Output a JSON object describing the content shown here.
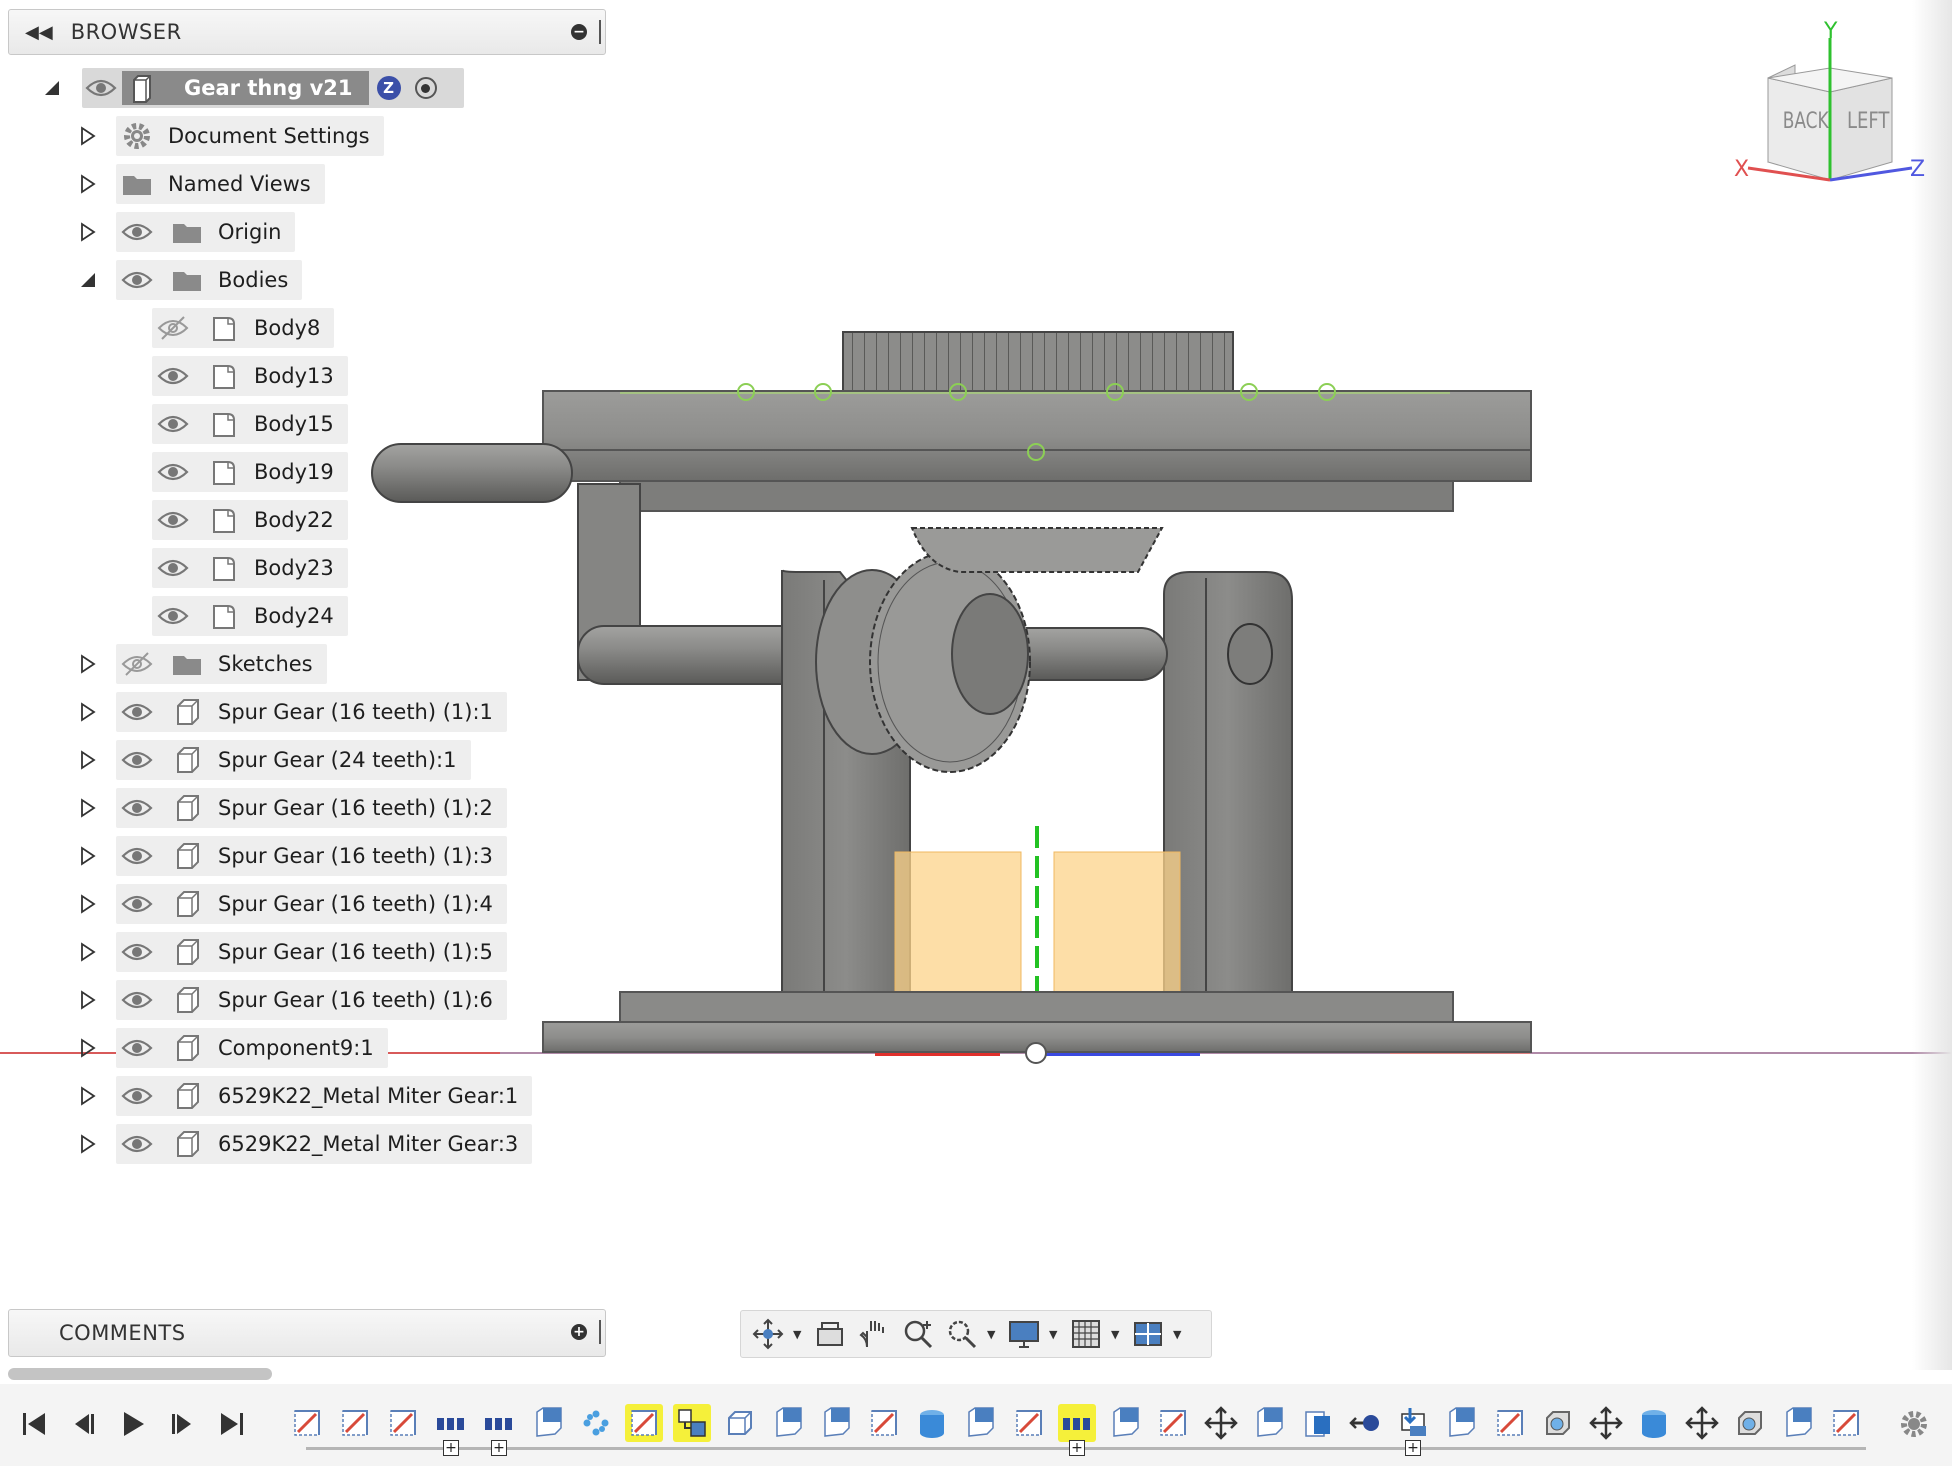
{
  "browser": {
    "title": "BROWSER",
    "root": {
      "label": "Gear thng v21",
      "badge": "Z"
    },
    "items": [
      {
        "label": "Document Settings",
        "icon": "gear",
        "expand": "closed",
        "eye": "none"
      },
      {
        "label": "Named Views",
        "icon": "folder",
        "expand": "closed",
        "eye": "none"
      },
      {
        "label": "Origin",
        "icon": "folder",
        "expand": "closed",
        "eye": "visible"
      },
      {
        "label": "Bodies",
        "icon": "folder",
        "expand": "open",
        "eye": "visible"
      },
      {
        "label": "Body8",
        "icon": "body",
        "expand": "none",
        "eye": "hidden",
        "child": true
      },
      {
        "label": "Body13",
        "icon": "body",
        "expand": "none",
        "eye": "visible",
        "child": true
      },
      {
        "label": "Body15",
        "icon": "body",
        "expand": "none",
        "eye": "visible",
        "child": true
      },
      {
        "label": "Body19",
        "icon": "body",
        "expand": "none",
        "eye": "visible",
        "child": true
      },
      {
        "label": "Body22",
        "icon": "body",
        "expand": "none",
        "eye": "visible",
        "child": true
      },
      {
        "label": "Body23",
        "icon": "body",
        "expand": "none",
        "eye": "visible",
        "child": true
      },
      {
        "label": "Body24",
        "icon": "body",
        "expand": "none",
        "eye": "visible",
        "child": true
      },
      {
        "label": "Sketches",
        "icon": "folder",
        "expand": "closed",
        "eye": "hidden"
      },
      {
        "label": "Spur Gear (16 teeth) (1):1",
        "icon": "component",
        "expand": "closed",
        "eye": "visible"
      },
      {
        "label": "Spur Gear (24 teeth):1",
        "icon": "component",
        "expand": "closed",
        "eye": "visible"
      },
      {
        "label": "Spur Gear (16 teeth) (1):2",
        "icon": "component",
        "expand": "closed",
        "eye": "visible"
      },
      {
        "label": "Spur Gear (16 teeth) (1):3",
        "icon": "component",
        "expand": "closed",
        "eye": "visible"
      },
      {
        "label": "Spur Gear (16 teeth) (1):4",
        "icon": "component",
        "expand": "closed",
        "eye": "visible"
      },
      {
        "label": "Spur Gear (16 teeth) (1):5",
        "icon": "component",
        "expand": "closed",
        "eye": "visible"
      },
      {
        "label": "Spur Gear (16 teeth) (1):6",
        "icon": "component",
        "expand": "closed",
        "eye": "visible"
      },
      {
        "label": "Component9:1",
        "icon": "component",
        "expand": "closed",
        "eye": "visible"
      },
      {
        "label": "6529K22_Metal Miter Gear:1",
        "icon": "component",
        "expand": "closed",
        "eye": "visible"
      },
      {
        "label": "6529K22_Metal Miter Gear:3",
        "icon": "component",
        "expand": "closed",
        "eye": "visible"
      }
    ]
  },
  "comments": {
    "title": "COMMENTS"
  },
  "viewcube": {
    "faces": [
      "BACK",
      "LEFT"
    ],
    "axes": [
      "X",
      "Y",
      "Z"
    ]
  },
  "navbar": {
    "tools": [
      "orbit-icon",
      "look-at-icon",
      "pan-icon",
      "zoom-icon",
      "fit-icon",
      "display-settings-icon",
      "grid-icon",
      "viewports-icon"
    ]
  },
  "timeline": {
    "playback": [
      "go-to-start",
      "step-back",
      "play",
      "step-forward",
      "go-to-end"
    ],
    "features": [
      {
        "icon": "sketch"
      },
      {
        "icon": "sketch"
      },
      {
        "icon": "sketch"
      },
      {
        "icon": "pattern",
        "plus": true
      },
      {
        "icon": "pattern",
        "plus": true
      },
      {
        "icon": "plane"
      },
      {
        "icon": "pattern-dots"
      },
      {
        "icon": "sketch",
        "highlight": true
      },
      {
        "icon": "joint",
        "highlight": true
      },
      {
        "icon": "box"
      },
      {
        "icon": "plane"
      },
      {
        "icon": "plane"
      },
      {
        "icon": "sketch"
      },
      {
        "icon": "cylinder"
      },
      {
        "icon": "plane"
      },
      {
        "icon": "sketch"
      },
      {
        "icon": "pattern",
        "highlight": true,
        "plus": true
      },
      {
        "icon": "plane"
      },
      {
        "icon": "sketch"
      },
      {
        "icon": "move"
      },
      {
        "icon": "plane"
      },
      {
        "icon": "plane-solid"
      },
      {
        "icon": "joint-origin"
      },
      {
        "icon": "insert",
        "plus": true
      },
      {
        "icon": "plane"
      },
      {
        "icon": "sketch"
      },
      {
        "icon": "shell"
      },
      {
        "icon": "move"
      },
      {
        "icon": "cylinder"
      },
      {
        "icon": "move"
      },
      {
        "icon": "shell"
      },
      {
        "icon": "plane"
      },
      {
        "icon": "sketch"
      }
    ]
  },
  "colors": {
    "model": "#8d8d8b",
    "model_dark": "#5d5d5b",
    "selection_fill": "#fcd38a",
    "axis_green": "#23c223",
    "axis_red": "#e0302c",
    "axis_blue": "#3b49e0",
    "highlight": "#f5f03a"
  }
}
